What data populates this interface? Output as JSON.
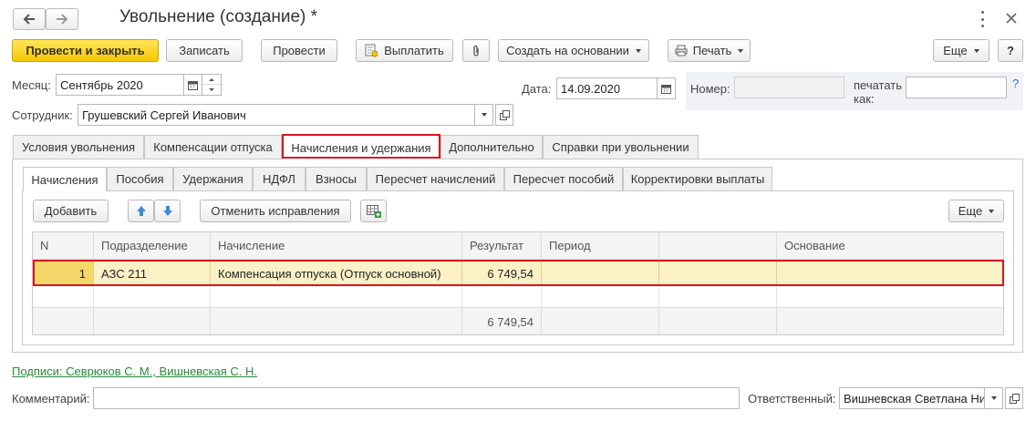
{
  "window": {
    "title": "Увольнение (создание) *",
    "nav_back_icon": "arrow-left-icon",
    "nav_forward_icon": "arrow-right-icon"
  },
  "toolbar": {
    "post_close": "Провести и закрыть",
    "save": "Записать",
    "post": "Провести",
    "pay": "Выплатить",
    "create_based": "Создать на основании",
    "print": "Печать",
    "more": "Еще",
    "help": "?"
  },
  "header": {
    "month_label": "Месяц:",
    "month_value": "Сентябрь 2020",
    "date_label": "Дата:",
    "date_value": "14.09.2020",
    "number_label": "Номер:",
    "number_value": "",
    "print_as_label_1": "печатать",
    "print_as_label_2": "как:",
    "print_as_value": "",
    "print_as_help": "?",
    "employee_label": "Сотрудник:",
    "employee_value": "Грушевский Сергей Иванович"
  },
  "main_tabs": [
    {
      "label": "Условия увольнения"
    },
    {
      "label": "Компенсации отпуска"
    },
    {
      "label": "Начисления и удержания"
    },
    {
      "label": "Дополнительно"
    },
    {
      "label": "Справки при увольнении"
    }
  ],
  "sub_tabs": [
    {
      "label": "Начисления"
    },
    {
      "label": "Пособия"
    },
    {
      "label": "Удержания"
    },
    {
      "label": "НДФЛ"
    },
    {
      "label": "Взносы"
    },
    {
      "label": "Пересчет начислений"
    },
    {
      "label": "Пересчет пособий"
    },
    {
      "label": "Корректировки выплаты"
    }
  ],
  "grid_toolbar": {
    "add": "Добавить",
    "cancel_fix": "Отменить исправления",
    "more": "Еще"
  },
  "grid": {
    "columns": [
      "N",
      "Подразделение",
      "Начисление",
      "Результат",
      "Период",
      "",
      "Основание"
    ],
    "rows": [
      [
        "1",
        "АЗС 211",
        "Компенсация отпуска (Отпуск основной)",
        "6 749,54",
        "",
        "",
        ""
      ]
    ],
    "total": "6 749,54"
  },
  "signatures_link": "Подписи: Севрюков С. М., Вишневская С. Н.",
  "footer": {
    "comment_label": "Комментарий:",
    "comment_value": "",
    "responsible_label": "Ответственный:",
    "responsible_value": "Вишневская Светлана Ни"
  },
  "colors": {
    "primary_button": "#f5c800",
    "selected_row": "#fbf1c7",
    "highlight": "#d9141e",
    "link": "#2a8a3a"
  }
}
